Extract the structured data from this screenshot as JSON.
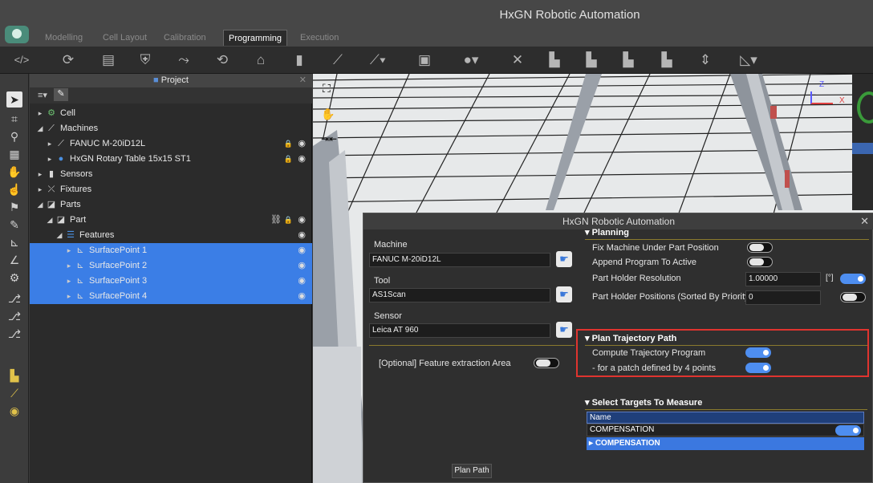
{
  "app": {
    "title": "HxGN Robotic Automation"
  },
  "tabs": [
    {
      "label": "Modelling",
      "active": false
    },
    {
      "label": "Cell Layout",
      "active": false
    },
    {
      "label": "Calibration",
      "active": false
    },
    {
      "label": "Programming",
      "active": true
    },
    {
      "label": "Execution",
      "active": false
    }
  ],
  "toolbar": {
    "icons": [
      "code-toggle-icon",
      "rotate-icon",
      "program-list-icon",
      "shield-icon",
      "path-icon",
      "robot-path-icon",
      "robot-home-icon",
      "probe-icon",
      "robot-arm-icon",
      "robot-arm-menu-icon",
      "screen-icon",
      "camera-icon",
      "tools-icon",
      "robot-ab-icon",
      "robot-ac-icon",
      "robot-c-icon",
      "robot-lock-icon",
      "pin-icon",
      "measure-icon"
    ]
  },
  "project": {
    "header": "Project",
    "tree": [
      {
        "label": "Cell",
        "level": 0,
        "caret": "▸",
        "icon": "cell-icon",
        "selected": false,
        "lock": false,
        "eye": false
      },
      {
        "label": "Machines",
        "level": 0,
        "caret": "◢",
        "icon": "machine-icon",
        "selected": false,
        "lock": false,
        "eye": false
      },
      {
        "label": "FANUC M-20iD12L",
        "level": 1,
        "caret": "▸",
        "icon": "robot-icon",
        "selected": false,
        "lock": true,
        "eye": true
      },
      {
        "label": "HxGN Rotary Table 15x15 ST1",
        "level": 1,
        "caret": "▸",
        "icon": "rotary-table-icon",
        "selected": false,
        "lock": true,
        "eye": true
      },
      {
        "label": "Sensors",
        "level": 0,
        "caret": "▸",
        "icon": "sensor-icon",
        "selected": false,
        "lock": false,
        "eye": false
      },
      {
        "label": "Fixtures",
        "level": 0,
        "caret": "▸",
        "icon": "fixture-icon",
        "selected": false,
        "lock": false,
        "eye": false
      },
      {
        "label": "Parts",
        "level": 0,
        "caret": "◢",
        "icon": "parts-icon",
        "selected": false,
        "lock": false,
        "eye": false
      },
      {
        "label": "Part",
        "level": 1,
        "caret": "◢",
        "icon": "part-icon",
        "selected": false,
        "lock": true,
        "eye": true,
        "link": true
      },
      {
        "label": "Features",
        "level": 2,
        "caret": "◢",
        "icon": "features-icon",
        "selected": false,
        "lock": false,
        "eye": true
      },
      {
        "label": "SurfacePoint 1",
        "level": 3,
        "caret": "▸",
        "icon": "surface-point-icon",
        "selected": true,
        "lock": false,
        "eye": true
      },
      {
        "label": "SurfacePoint 2",
        "level": 3,
        "caret": "▸",
        "icon": "surface-point-icon",
        "selected": true,
        "lock": false,
        "eye": true
      },
      {
        "label": "SurfacePoint 3",
        "level": 3,
        "caret": "▸",
        "icon": "surface-point-icon",
        "selected": true,
        "lock": false,
        "eye": true
      },
      {
        "label": "SurfacePoint 4",
        "level": 3,
        "caret": "▸",
        "icon": "surface-point-icon",
        "selected": true,
        "lock": false,
        "eye": true
      }
    ]
  },
  "dialog": {
    "title": "HxGN Robotic Automation",
    "machine_label": "Machine",
    "machine_value": "FANUC M-20iD12L",
    "tool_label": "Tool",
    "tool_value": "AS1Scan",
    "sensor_label": "Sensor",
    "sensor_value": "Leica AT 960",
    "feature_area_label": "[Optional] Feature extraction Area",
    "planning": {
      "header": "Planning",
      "fix_machine": "Fix Machine Under Part Position",
      "append_program": "Append Program To Active",
      "holder_resolution": "Part Holder Resolution",
      "holder_resolution_value": "1.00000",
      "holder_resolution_unit": "[°]",
      "holder_positions": "Part Holder Positions (Sorted By Priority)",
      "holder_positions_value": "0"
    },
    "trajectory": {
      "header": "Plan Trajectory Path",
      "compute": "Compute Trajectory Program",
      "patch": "- for a patch defined by 4 points"
    },
    "targets": {
      "header": "Select Targets To Measure",
      "column": "Name",
      "row": "COMPENSATION",
      "group": "COMPENSATION"
    },
    "plan_path_button": "Plan Path"
  },
  "viewport": {
    "axis_x": "X",
    "axis_z": "Z"
  }
}
